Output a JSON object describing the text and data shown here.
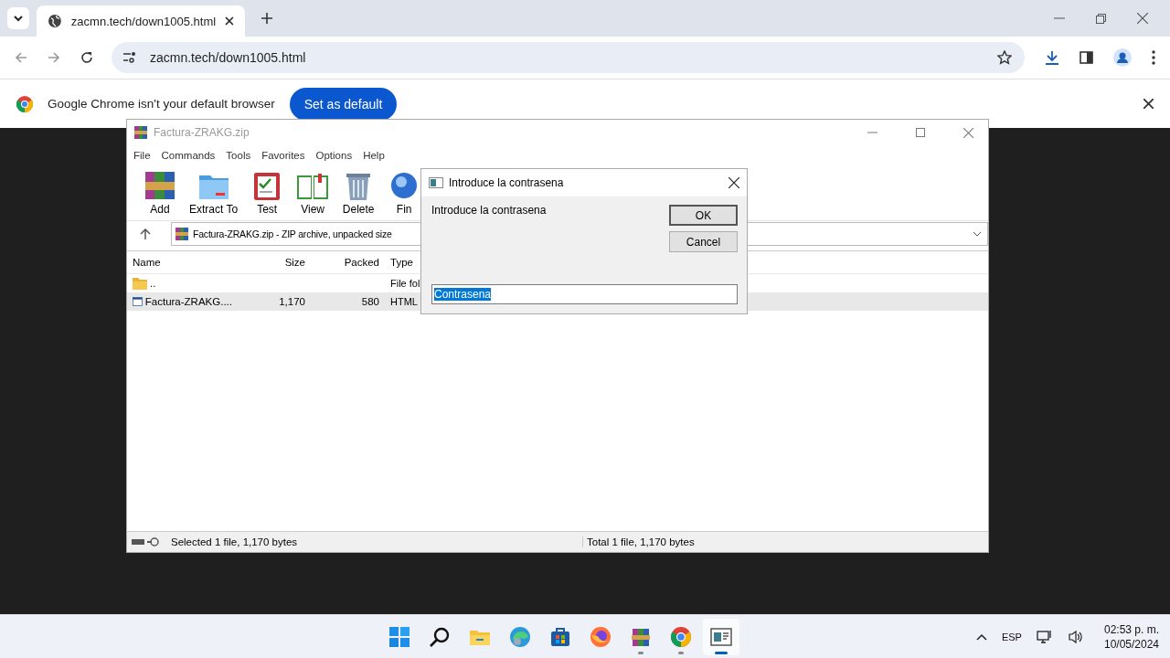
{
  "browser": {
    "tabs": [
      {
        "title": "zacmn.tech/down1005.html",
        "selected": true
      }
    ],
    "address": "zacmn.tech/down1005.html",
    "infobar": {
      "message": "Google Chrome isn't your default browser",
      "button": "Set as default"
    }
  },
  "winrar": {
    "title": "Factura-ZRAKG.zip",
    "menu": [
      "File",
      "Commands",
      "Tools",
      "Favorites",
      "Options",
      "Help"
    ],
    "toolbar": [
      "Add",
      "Extract To",
      "Test",
      "View",
      "Delete",
      "Fin"
    ],
    "path": "Factura-ZRAKG.zip - ZIP archive, unpacked size",
    "columns": [
      "Name",
      "Size",
      "Packed",
      "Type"
    ],
    "rows": [
      {
        "kind": "folder",
        "name": "..",
        "size": "",
        "packed": "",
        "type": "File fol",
        "selected": false
      },
      {
        "kind": "file",
        "name": "Factura-ZRAKG....",
        "size": "1,170",
        "packed": "580",
        "type": "HTML",
        "selected": true
      }
    ],
    "status": {
      "left": "Selected 1 file, 1,170 bytes",
      "right": "Total 1 file, 1,170 bytes"
    }
  },
  "dialog": {
    "title": "Introduce la contrasena",
    "message": "Introduce la contrasena",
    "buttons": [
      {
        "label": "OK",
        "default": true
      },
      {
        "label": "Cancel",
        "default": false
      }
    ],
    "input": {
      "value": "Contrasena",
      "selected": true
    }
  },
  "taskbar": {
    "apps": [
      {
        "running": false,
        "active": false
      },
      {
        "running": false,
        "active": false
      },
      {
        "running": false,
        "active": false
      },
      {
        "running": false,
        "active": false
      },
      {
        "running": false,
        "active": false
      },
      {
        "running": false,
        "active": false
      },
      {
        "running": true,
        "active": false
      },
      {
        "running": true,
        "active": false
      },
      {
        "running": true,
        "active": true
      }
    ],
    "language": "ESP",
    "time": "02:53 p. m.",
    "date": "10/05/2024"
  }
}
